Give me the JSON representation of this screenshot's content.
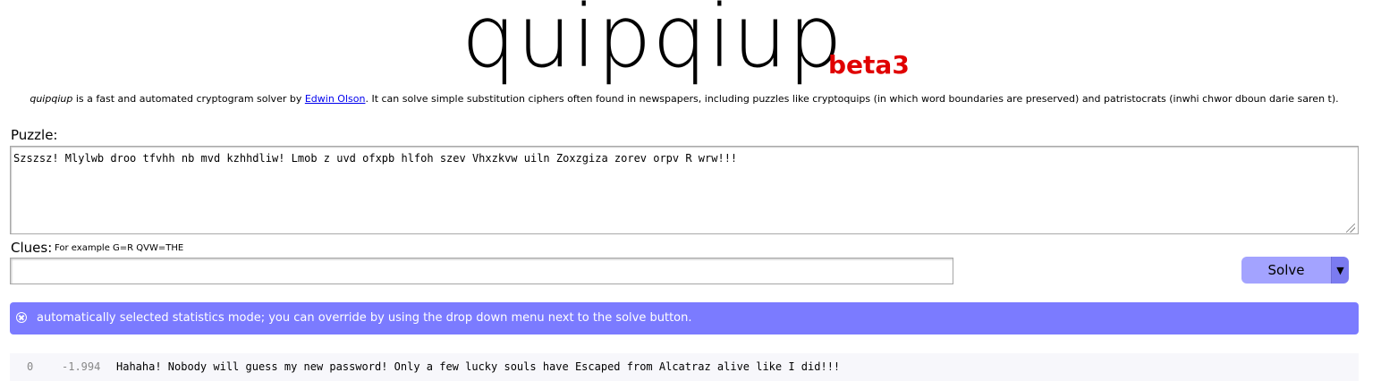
{
  "logo": {
    "main": "quipqiup",
    "beta": "beta3"
  },
  "description": {
    "app_name": "quipqiup",
    "part1": " is a fast and automated cryptogram solver by ",
    "author_link": "Edwin Olson",
    "part2": ". It can solve simple substitution ciphers often found in newspapers, including puzzles like cryptoquips (in which word boundaries are preserved) and patristocrats (inwhi chwor dboun darie saren t)."
  },
  "puzzle": {
    "label": "Puzzle:",
    "value": "Szszsz! Mlylwb droo tfvhh nb mvd kzhhdliw! Lmob z uvd ofxpb hlfoh szev Vhxzkvw uiln Zoxzgiza zorev orpv R wrw!!!"
  },
  "clues": {
    "label": "Clues:",
    "hint": "For example G=R QVW=THE",
    "value": ""
  },
  "solve": {
    "label": "Solve",
    "dropdown_glyph": "▼"
  },
  "info": {
    "icon": "close-circle-icon",
    "text": "automatically selected statistics mode; you can override by using the drop down menu next to the solve button."
  },
  "results": [
    {
      "index": "0",
      "score": "-1.994",
      "text": "Hahaha! Nobody will guess my new password! Only a few lucky souls have Escaped from Alcatraz alive like I did!!!"
    }
  ],
  "colors": {
    "beta": "#e00000",
    "solve_button": "#a3a3ff",
    "solve_dropdown": "#7b7bf0",
    "info_banner": "#7b7bff",
    "link": "#0000ee"
  }
}
